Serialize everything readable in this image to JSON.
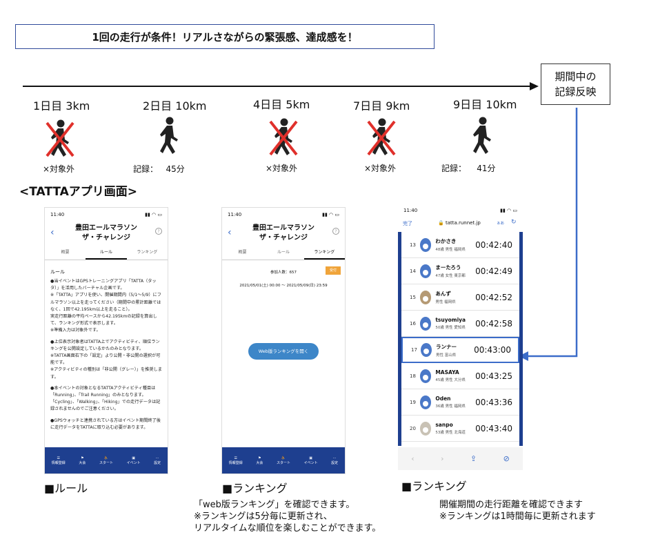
{
  "headline": "1回の走行が条件！リアルさながらの緊張感、達成感を！",
  "period_box": [
    "期間中の",
    "記録反映"
  ],
  "timeline_days": [
    {
      "label": "1日目 3km",
      "note": "×対象外"
    },
    {
      "label": "2日目 10km",
      "note_prefix": "記録：",
      "note_value": "45分"
    },
    {
      "label": "4日目 5km",
      "note": "×対象外"
    },
    {
      "label": "7日目 9km",
      "note": "×対象外"
    },
    {
      "label": "9日目 10km",
      "note_prefix": "記録：",
      "note_value": "41分"
    }
  ],
  "section_title": "<TATTAアプリ画面>",
  "phone1": {
    "time": "11:40",
    "title1": "豊田エールマラソン",
    "title2": "ザ・チャレンジ",
    "tabs": [
      "概要",
      "ルール",
      "ランキング"
    ],
    "rule_heading": "ルール",
    "rule_text": [
      "●当イベントはGPSトレーニングアプリ「TATTA（タッタ）」を活用したバーチャル企画です。",
      "※「TATTA」アプリを使い、開催期間内（5/1〜5/9）にフルマラソン以上を走ってください（期間中の累計距離ではなく、1回で42.195km以上を走ること）。",
      "実走行距離の平均ペースから42.195kmの記録を算出して、ランキング形式で表示します。",
      "※準備入力は対象外です。",
      "●上位表示対象者はTATTA上でアクティビティ、順位ランキングを公開設定しているかたのみとなります。",
      "※TATTA画面右下の「設定」より公開・非公開の選択が可能です。",
      "※アクティビティの種別は「非公開（グレー）」を推奨します。",
      "●本イベントの対象となるTATTAアクティビティ種目は「Running」、「Trail Running」のみとなります。「Cycling」、「Walking」、「Hiking」での走行データは記録されませんのでご注意ください。",
      "●GPSウォッチと連携されている方はイベント期間終了後に走行データをTATTAに取り込む必要があります。"
    ],
    "bottom_items": [
      "情報登録",
      "大会",
      "スタート",
      "イベント",
      "設定"
    ]
  },
  "phone2": {
    "time": "11:40",
    "title1": "豊田エールマラソン",
    "title2": "ザ・チャレンジ",
    "tabs": [
      "概要",
      "ルール",
      "ランキング"
    ],
    "participants": "参加人数：657",
    "badge": "受付",
    "period": "2021/05/01(土) 00:00 〜 2021/05/09(日) 23:59",
    "button": "Web版ランキングを開く",
    "bottom_items": [
      "情報登録",
      "大会",
      "スタート",
      "イベント",
      "設定"
    ]
  },
  "phone3": {
    "time": "11:40",
    "done": "完了",
    "url": "tatta.runnet.jp",
    "aa": "ぁあ",
    "rows": [
      {
        "rank": "13",
        "name": "わかさき",
        "sub": "48歳 男性 福岡県",
        "time": "00:42:40"
      },
      {
        "rank": "14",
        "name": "まーたろう",
        "sub": "47歳 女性 東京都",
        "time": "00:42:49"
      },
      {
        "rank": "15",
        "name": "あんず",
        "sub": "男性 福岡県",
        "time": "00:42:52"
      },
      {
        "rank": "16",
        "name": "tsuyomiya",
        "sub": "50歳 男性 愛知県",
        "time": "00:42:58"
      },
      {
        "rank": "17",
        "name": "ランナー",
        "sub": "男性 富山県",
        "time": "00:43:00"
      },
      {
        "rank": "18",
        "name": "MASAYA",
        "sub": "45歳 男性 大分県",
        "time": "00:43:25"
      },
      {
        "rank": "19",
        "name": "Oden",
        "sub": "36歳 男性 福岡県",
        "time": "00:43:36"
      },
      {
        "rank": "20",
        "name": "sanpo",
        "sub": "53歳 男性 北海道",
        "time": "00:43:40"
      }
    ]
  },
  "captions": [
    "■ルール",
    "■ランキング",
    "■ランキング"
  ],
  "desc2": [
    "「web版ランキング」を確認できます。",
    "※ランキングは5分毎に更新され、",
    "リアルタイムな順位を楽しむことができます。"
  ],
  "desc3": [
    "開催期間の走行距離を確認できます",
    "※ランキングは1時間毎に更新されます"
  ],
  "colors": {
    "accent": "#1e3f8f",
    "highlight": "#3b6cc9",
    "cross": "#e0302b",
    "badge": "#f0a43a"
  }
}
